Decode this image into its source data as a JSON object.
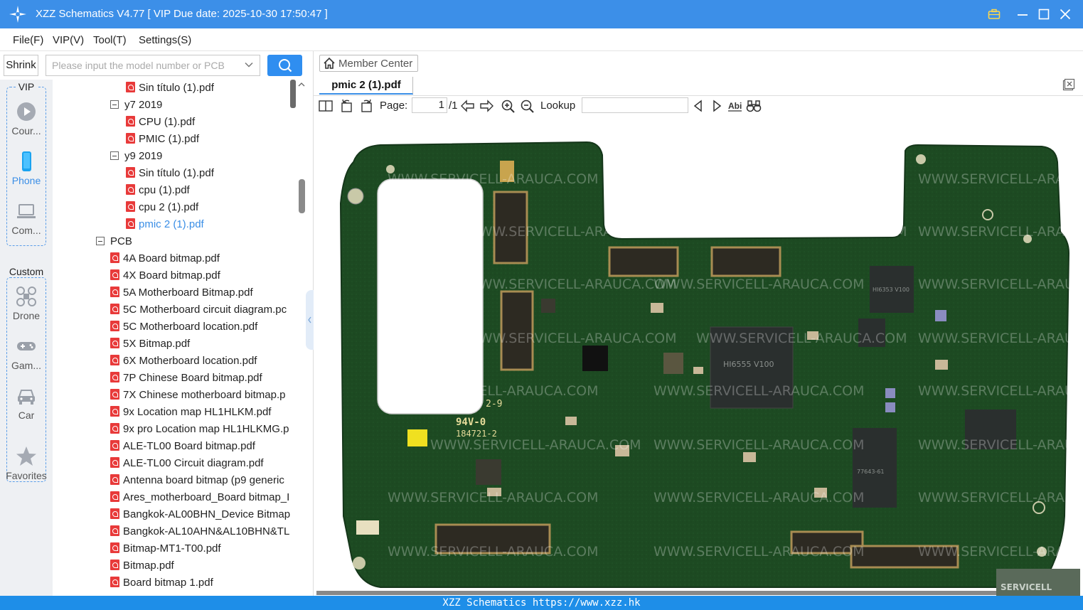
{
  "app": {
    "title": "XZZ Schematics V4.77 [ VIP Due date: 2025-10-30 17:50:47 ]"
  },
  "menu": [
    "File(F)",
    "VIP(V)",
    "Tool(T)",
    "Settings(S)"
  ],
  "search": {
    "shrink_label": "Shrink",
    "placeholder": "Please input the model number or PCB"
  },
  "sidebar": {
    "vip_label": "VIP",
    "custom_label": "Custom",
    "categories": [
      {
        "label": "Cour...",
        "icon": "play-icon"
      },
      {
        "label": "Phone",
        "icon": "phone-icon",
        "active": true
      },
      {
        "label": "Com...",
        "icon": "laptop-icon"
      },
      {
        "label": "Drone",
        "icon": "drone-icon"
      },
      {
        "label": "Gam...",
        "icon": "gamepad-icon"
      },
      {
        "label": "Car",
        "icon": "car-icon"
      },
      {
        "label": "Favorites",
        "icon": "star-icon"
      }
    ],
    "accent": "#3a8ee6"
  },
  "tree": [
    {
      "label": "Sin título (1).pdf",
      "type": "file",
      "level": 3
    },
    {
      "label": "y7 2019",
      "type": "folder",
      "level": 2
    },
    {
      "label": "CPU (1).pdf",
      "type": "file",
      "level": 3
    },
    {
      "label": "PMIC (1).pdf",
      "type": "file",
      "level": 3
    },
    {
      "label": "y9 2019",
      "type": "folder",
      "level": 2
    },
    {
      "label": "Sin título (1).pdf",
      "type": "file",
      "level": 3
    },
    {
      "label": "cpu (1).pdf",
      "type": "file",
      "level": 3
    },
    {
      "label": "cpu 2 (1).pdf",
      "type": "file",
      "level": 3
    },
    {
      "label": "pmic 2 (1).pdf",
      "type": "file",
      "level": 3,
      "selected": true
    },
    {
      "label": "PCB",
      "type": "folder",
      "level": 1
    },
    {
      "label": "4A Board bitmap.pdf",
      "type": "file",
      "level": 2
    },
    {
      "label": "4X Board bitmap.pdf",
      "type": "file",
      "level": 2
    },
    {
      "label": "5A Motherboard Bitmap.pdf",
      "type": "file",
      "level": 2
    },
    {
      "label": "5C Motherboard circuit diagram.pc",
      "type": "file",
      "level": 2
    },
    {
      "label": "5C Motherboard location.pdf",
      "type": "file",
      "level": 2
    },
    {
      "label": "5X Bitmap.pdf",
      "type": "file",
      "level": 2
    },
    {
      "label": "6X Motherboard location.pdf",
      "type": "file",
      "level": 2
    },
    {
      "label": "7P Chinese Board bitmap.pdf",
      "type": "file",
      "level": 2
    },
    {
      "label": "7X Chinese motherboard bitmap.p",
      "type": "file",
      "level": 2
    },
    {
      "label": "9x Location map HL1HLKM.pdf",
      "type": "file",
      "level": 2
    },
    {
      "label": "9x pro Location map HL1HLKMG.p",
      "type": "file",
      "level": 2
    },
    {
      "label": "ALE-TL00 Board bitmap.pdf",
      "type": "file",
      "level": 2
    },
    {
      "label": "ALE-TL00 Circuit diagram.pdf",
      "type": "file",
      "level": 2
    },
    {
      "label": "Antenna board bitmap (p9 generic",
      "type": "file",
      "level": 2
    },
    {
      "label": "Ares_motherboard_Board bitmap_I",
      "type": "file",
      "level": 2
    },
    {
      "label": "Bangkok-AL00BHN_Device Bitmap",
      "type": "file",
      "level": 2
    },
    {
      "label": "Bangkok-AL10AHN&AL10BHN&TL",
      "type": "file",
      "level": 2
    },
    {
      "label": "Bitmap-MT1-T00.pdf",
      "type": "file",
      "level": 2
    },
    {
      "label": "Bitmap.pdf",
      "type": "file",
      "level": 2
    },
    {
      "label": "Board bitmap 1.pdf",
      "type": "file",
      "level": 2
    }
  ],
  "viewer": {
    "member_center": "Member Center",
    "doc_tab": "pmic 2 (1).pdf",
    "page_label": "Page:",
    "page_current": "1",
    "page_total": "/1",
    "lookup_label": "Lookup",
    "lookup_value": "",
    "board_watermark": "WWW.SERVICELL-ARAUCA.COM",
    "silk_1": "94V-0",
    "silk_2": "184721-2",
    "silk_3": "2-9",
    "chip_1": "HI6555 V100",
    "chip_2": "HI6353 V100",
    "chip_3": "77643-61",
    "chip_4": "SERVICELL"
  },
  "status": {
    "text": "XZZ Schematics https://www.xzz.hk"
  }
}
